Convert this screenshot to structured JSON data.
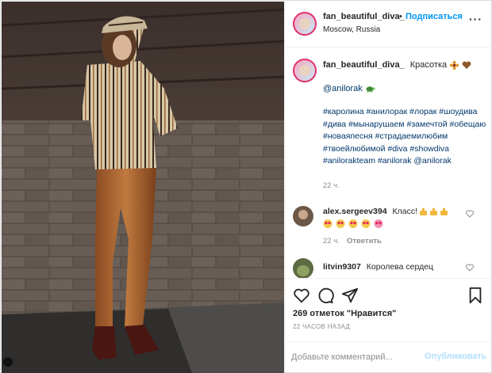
{
  "post": {
    "username": "fan_beautiful_diva_",
    "separator": "•",
    "follow_label": "Подписаться",
    "location": "Moscow, Russia",
    "more_label": "···"
  },
  "caption": {
    "username": "fan_beautiful_diva_",
    "text": "Красотка",
    "mention": "@anilorak",
    "hashtags": "#каролина #анилорак #лорак #шоудива #дива #мынарушаем #замечтой #обещаю #новаяпесня #страдаемилюбим #твоейлюбимой #diva #showdiva #anilorakteam #anilorak @anilorak",
    "time": "22 ч."
  },
  "comments": [
    {
      "username": "alex.sergeev394",
      "text": "Класс!",
      "time": "22 ч.",
      "reply_label": "Ответить"
    },
    {
      "username": "litvin9307",
      "text": "Королева сердец"
    }
  ],
  "actions": {
    "likes": "269 отметок \"Нравится\"",
    "posted_ago": "22 ЧАСОВ НАЗАД"
  },
  "composer": {
    "placeholder": "Добавьте комментарий...",
    "publish_label": "Опубликовать"
  },
  "icons": {
    "like": "heart-icon",
    "comment": "comment-icon",
    "share": "share-icon",
    "save": "bookmark-icon",
    "more": "more-icon"
  },
  "colors": {
    "link_blue": "#0095f6",
    "hashtag_blue": "#00376b",
    "muted_gray": "#8e8e8e",
    "publish_disabled": "#b2dffc"
  }
}
